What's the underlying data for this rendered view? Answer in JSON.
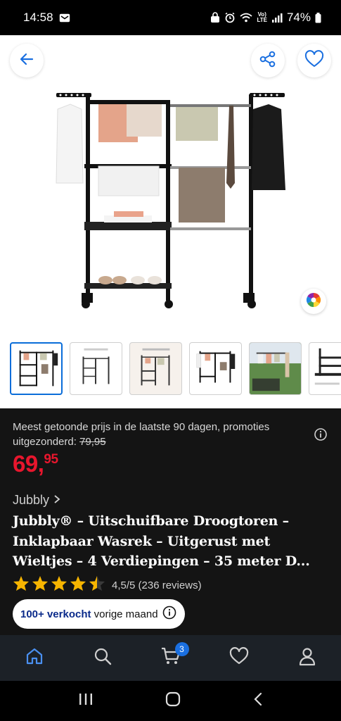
{
  "status_bar": {
    "time": "14:58",
    "battery": "74%",
    "network": "VoLTE"
  },
  "hero": {
    "back_icon": "arrow-left-icon",
    "share_icon": "share-icon",
    "favorite_icon": "heart-icon",
    "color_wheel_icon": "color-wheel-icon"
  },
  "thumbnails": [
    {
      "name": "thumb-1",
      "caption": ""
    },
    {
      "name": "thumb-2",
      "caption": ""
    },
    {
      "name": "thumb-3",
      "caption": ""
    },
    {
      "name": "thumb-4",
      "caption": ""
    },
    {
      "name": "thumb-5",
      "caption": ""
    },
    {
      "name": "thumb-6",
      "caption": ""
    }
  ],
  "product": {
    "price_note_prefix": "Meest getoonde prijs in de laatste 90 dagen, promoties uitgezonderd: ",
    "old_price": "79,95",
    "price_main": "69",
    "price_cents": "95",
    "brand": "Jubbly",
    "title": "Jubbly® – Uitschuifbare Droogtoren – Inklapbaar Wasrek – Uitgerust met Wieltjes – 4 Verdiepingen – 35 meter D...",
    "rating_value": 4.5,
    "rating_text": "4,5/5 (236 reviews)",
    "sold_bold": "100+ verkocht",
    "sold_rest": " vorige maand"
  },
  "bottom_nav": {
    "cart_count": "3",
    "items": [
      "home-icon",
      "search-icon",
      "cart-icon",
      "heart-icon",
      "account-icon"
    ]
  },
  "colors": {
    "price_red": "#e8162d",
    "accent_blue": "#1a6fe0",
    "nav_bg": "#1c2127"
  }
}
